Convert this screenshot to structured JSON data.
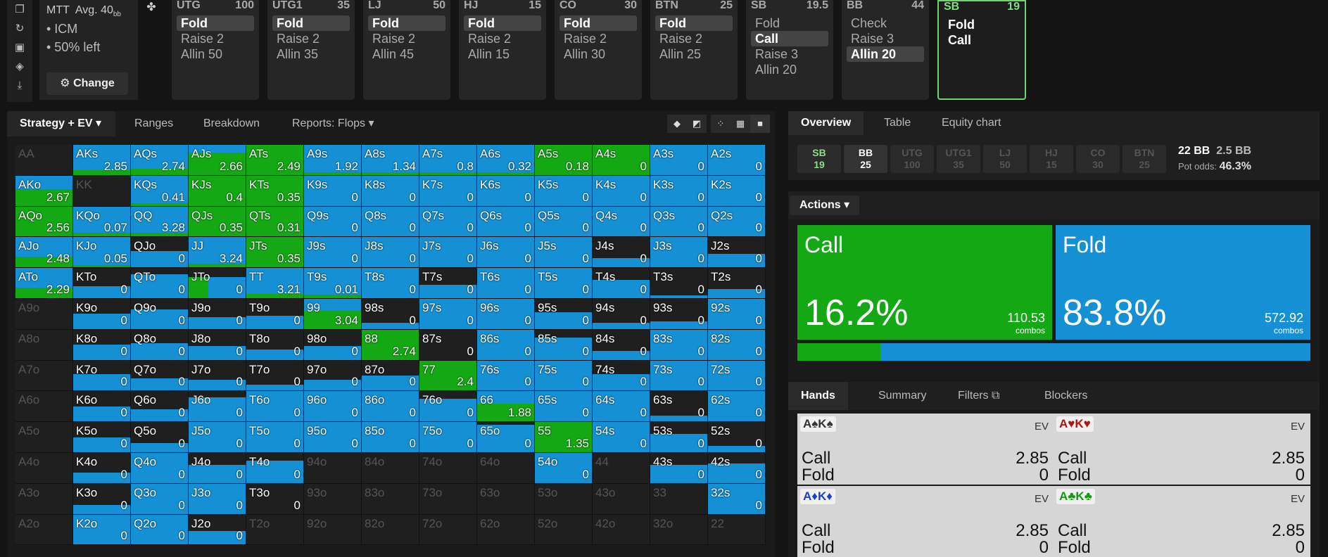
{
  "left_icons": [
    "bookmark-icon",
    "refresh-icon",
    "save-icon",
    "gamepad-icon",
    "collapse-icon"
  ],
  "info": {
    "title": "MTT",
    "avg_label": "Avg. 40",
    "avg_unit": "bb",
    "items": [
      "• ICM",
      "• 50% left"
    ],
    "change_label": "Change",
    "change_icon": "⚙"
  },
  "positions": [
    {
      "name": "UTG",
      "stack": "100",
      "actions": [
        "Fold",
        "Raise 2",
        "Allin 50"
      ],
      "selected": 0
    },
    {
      "name": "UTG1",
      "stack": "35",
      "actions": [
        "Fold",
        "Raise 2",
        "Allin 35"
      ],
      "selected": 0
    },
    {
      "name": "LJ",
      "stack": "50",
      "actions": [
        "Fold",
        "Raise 2",
        "Allin 45"
      ],
      "selected": 0
    },
    {
      "name": "HJ",
      "stack": "15",
      "actions": [
        "Fold",
        "Raise 2",
        "Allin 15"
      ],
      "selected": 0
    },
    {
      "name": "CO",
      "stack": "30",
      "actions": [
        "Fold",
        "Raise 2",
        "Allin 30"
      ],
      "selected": 0
    },
    {
      "name": "BTN",
      "stack": "25",
      "actions": [
        "Fold",
        "Raise 2",
        "Allin 25"
      ],
      "selected": 0
    },
    {
      "name": "SB",
      "stack": "19.5",
      "actions": [
        "Fold",
        "Call",
        "Raise 3",
        "Allin 20"
      ],
      "selected": 1
    },
    {
      "name": "BB",
      "stack": "44",
      "actions": [
        "Check",
        "Raise 3",
        "Allin 20"
      ],
      "selected": 2
    },
    {
      "name": "SB",
      "stack": "19",
      "actions": [
        "Fold",
        "Call"
      ],
      "selected": -1,
      "active": true
    }
  ],
  "grid_tabs": [
    "Strategy + EV",
    "Ranges",
    "Breakdown",
    "Reports: Flops"
  ],
  "grid_tab_active": 0,
  "view_buttons": [
    "◆",
    "◩",
    "⁘",
    "▦",
    "■"
  ],
  "colors": {
    "call": "#14a814",
    "fold": "#1590d4",
    "empty": "#1f1f1f"
  },
  "hands": [
    [
      "AA",
      "",
      -1
    ],
    [
      "AKs",
      "2.85",
      0.15
    ],
    [
      "AQs",
      "2.74",
      0.2
    ],
    [
      "AJs",
      "2.66",
      0.75
    ],
    [
      "ATs",
      "2.49",
      1
    ],
    [
      "A9s",
      "1.92",
      0.08
    ],
    [
      "A8s",
      "1.34",
      0.08
    ],
    [
      "A7s",
      "0.8",
      0.1
    ],
    [
      "A6s",
      "0.32",
      0.1
    ],
    [
      "A5s",
      "0.18",
      1
    ],
    [
      "A4s",
      "0",
      1,
      0.05
    ],
    [
      "A3s",
      "0",
      0
    ],
    [
      "A2s",
      "0",
      0
    ],
    [
      "AKo",
      "2.67",
      0.55
    ],
    [
      "KK",
      "",
      -1
    ],
    [
      "KQs",
      "0.41",
      0.08
    ],
    [
      "KJs",
      "0.4",
      1
    ],
    [
      "KTs",
      "0.35",
      1
    ],
    [
      "K9s",
      "0",
      0
    ],
    [
      "K8s",
      "0",
      0
    ],
    [
      "K7s",
      "0",
      0
    ],
    [
      "K6s",
      "0",
      0
    ],
    [
      "K5s",
      "0",
      0
    ],
    [
      "K4s",
      "0",
      0
    ],
    [
      "K3s",
      "0",
      0
    ],
    [
      "K2s",
      "0",
      0
    ],
    [
      "AQo",
      "2.56",
      1
    ],
    [
      "KQo",
      "0.07",
      0.12
    ],
    [
      "QQ",
      "3.28",
      0.12
    ],
    [
      "QJs",
      "0.35",
      1
    ],
    [
      "QTs",
      "0.31",
      1
    ],
    [
      "Q9s",
      "0",
      0
    ],
    [
      "Q8s",
      "0",
      0
    ],
    [
      "Q7s",
      "0",
      0
    ],
    [
      "Q6s",
      "0",
      0
    ],
    [
      "Q5s",
      "0",
      0
    ],
    [
      "Q4s",
      "0",
      0
    ],
    [
      "Q3s",
      "0",
      0
    ],
    [
      "Q2s",
      "0",
      0
    ],
    [
      "AJo",
      "2.48",
      0.35
    ],
    [
      "KJo",
      "0.05",
      0.08
    ],
    [
      "QJo",
      "0",
      0,
      0.55
    ],
    [
      "JJ",
      "3.24",
      0.12
    ],
    [
      "JTs",
      "0.35",
      1
    ],
    [
      "J9s",
      "0",
      0
    ],
    [
      "J8s",
      "0",
      0
    ],
    [
      "J7s",
      "0",
      0
    ],
    [
      "J6s",
      "0",
      0
    ],
    [
      "J5s",
      "0",
      0
    ],
    [
      "J4s",
      "0",
      0,
      0.3
    ],
    [
      "J3s",
      "0",
      0
    ],
    [
      "J2s",
      "0",
      0,
      0.45
    ],
    [
      "ATo",
      "2.29",
      0.35
    ],
    [
      "KTo",
      "0",
      0,
      0.4
    ],
    [
      "QTo",
      "0",
      0,
      0.8
    ],
    [
      "JTo",
      "0",
      0,
      0.7,
      0.35
    ],
    [
      "TT",
      "3.21",
      0.15
    ],
    [
      "T9s",
      "0.01",
      0.12
    ],
    [
      "T8s",
      "0",
      0
    ],
    [
      "T7s",
      "0",
      0,
      0.45
    ],
    [
      "T6s",
      "0",
      0
    ],
    [
      "T5s",
      "0",
      0
    ],
    [
      "T4s",
      "0",
      0,
      0.6
    ],
    [
      "T3s",
      "0",
      0,
      0.1
    ],
    [
      "T2s",
      "0",
      0,
      0.3
    ],
    [
      "A9o",
      "",
      -1
    ],
    [
      "K9o",
      "0",
      0,
      0.5
    ],
    [
      "Q9o",
      "0",
      0,
      0.65
    ],
    [
      "J9o",
      "0",
      0,
      0.4
    ],
    [
      "T9o",
      "0",
      0,
      0.45
    ],
    [
      "99",
      "3.04",
      0.6
    ],
    [
      "98s",
      "0",
      0,
      0.2
    ],
    [
      "97s",
      "0",
      0
    ],
    [
      "96s",
      "0",
      0
    ],
    [
      "95s",
      "0",
      0,
      0.55
    ],
    [
      "94s",
      "0",
      0,
      0.2
    ],
    [
      "93s",
      "0",
      0,
      0.25
    ],
    [
      "92s",
      "0",
      0
    ],
    [
      "A8o",
      "",
      -1
    ],
    [
      "K8o",
      "0",
      0,
      0.5
    ],
    [
      "Q8o",
      "0",
      0,
      0.55
    ],
    [
      "J8o",
      "0",
      0,
      0.45
    ],
    [
      "T8o",
      "0",
      0,
      0.35
    ],
    [
      "98o",
      "0",
      0,
      0.45
    ],
    [
      "88",
      "2.74",
      1
    ],
    [
      "87s",
      "0",
      0,
      0
    ],
    [
      "86s",
      "0",
      0
    ],
    [
      "85s",
      "0",
      0,
      0.75
    ],
    [
      "84s",
      "0",
      0,
      0.3
    ],
    [
      "83s",
      "0",
      0
    ],
    [
      "82s",
      "0",
      0
    ],
    [
      "A7o",
      "",
      -1
    ],
    [
      "K7o",
      "0",
      0,
      0.55
    ],
    [
      "Q7o",
      "0",
      0,
      0.4
    ],
    [
      "J7o",
      "0",
      0,
      0.35
    ],
    [
      "T7o",
      "0",
      0,
      0.2
    ],
    [
      "97o",
      "0",
      0,
      0.35
    ],
    [
      "87o",
      "0",
      0,
      0.5
    ],
    [
      "77",
      "2.4",
      1
    ],
    [
      "76s",
      "0",
      0
    ],
    [
      "75s",
      "0",
      0
    ],
    [
      "74s",
      "0",
      0,
      0.55
    ],
    [
      "73s",
      "0",
      0
    ],
    [
      "72s",
      "0",
      0
    ],
    [
      "A6o",
      "",
      -1
    ],
    [
      "K6o",
      "0",
      0,
      0.5
    ],
    [
      "Q6o",
      "0",
      0,
      0.4
    ],
    [
      "J6o",
      "0",
      0,
      0.8
    ],
    [
      "T6o",
      "0",
      0
    ],
    [
      "96o",
      "0",
      0
    ],
    [
      "86o",
      "0",
      0
    ],
    [
      "76o",
      "0",
      0,
      0.75
    ],
    [
      "66",
      "1.88",
      0.6
    ],
    [
      "65s",
      "0",
      0
    ],
    [
      "64s",
      "0",
      0
    ],
    [
      "63s",
      "0",
      0,
      0.2
    ],
    [
      "62s",
      "0",
      0
    ],
    [
      "A5o",
      "",
      -1
    ],
    [
      "K5o",
      "0",
      0,
      0.5
    ],
    [
      "Q5o",
      "0",
      0,
      0.3
    ],
    [
      "J5o",
      "0",
      0
    ],
    [
      "T5o",
      "0",
      0
    ],
    [
      "95o",
      "0",
      0
    ],
    [
      "85o",
      "0",
      0
    ],
    [
      "75o",
      "0",
      0
    ],
    [
      "65o",
      "0",
      0,
      0.9
    ],
    [
      "55",
      "1.35",
      1
    ],
    [
      "54s",
      "0",
      0
    ],
    [
      "53s",
      "0",
      0,
      0.6
    ],
    [
      "52s",
      "0",
      0,
      0.2
    ],
    [
      "A4o",
      "",
      -1
    ],
    [
      "K4o",
      "0",
      0,
      0.35
    ],
    [
      "Q4o",
      "0",
      0
    ],
    [
      "J4o",
      "0",
      0,
      0.6
    ],
    [
      "T4o",
      "0",
      0,
      0.75
    ],
    [
      "94o",
      "",
      -1
    ],
    [
      "84o",
      "",
      -1
    ],
    [
      "74o",
      "",
      -1
    ],
    [
      "64o",
      "",
      -1
    ],
    [
      "54o",
      "0",
      0
    ],
    [
      "44",
      "",
      -1
    ],
    [
      "43s",
      "0",
      0,
      0.6
    ],
    [
      "42s",
      "0",
      0,
      0.65
    ],
    [
      "A3o",
      "",
      -1
    ],
    [
      "K3o",
      "0",
      0,
      0.3
    ],
    [
      "Q3o",
      "0",
      0
    ],
    [
      "J3o",
      "0",
      0
    ],
    [
      "T3o",
      "0",
      0,
      0
    ],
    [
      "93o",
      "",
      -1
    ],
    [
      "83o",
      "",
      -1
    ],
    [
      "73o",
      "",
      -1
    ],
    [
      "63o",
      "",
      -1
    ],
    [
      "53o",
      "",
      -1
    ],
    [
      "43o",
      "",
      -1
    ],
    [
      "33",
      "",
      -1
    ],
    [
      "32s",
      "0",
      0
    ],
    [
      "A2o",
      "",
      -1
    ],
    [
      "K2o",
      "0",
      0
    ],
    [
      "Q2o",
      "0",
      0
    ],
    [
      "J2o",
      "0",
      0,
      0.45
    ],
    [
      "T2o",
      "",
      -1
    ],
    [
      "92o",
      "",
      -1
    ],
    [
      "82o",
      "",
      -1
    ],
    [
      "72o",
      "",
      -1
    ],
    [
      "62o",
      "",
      -1
    ],
    [
      "52o",
      "",
      -1
    ],
    [
      "42o",
      "",
      -1
    ],
    [
      "32o",
      "",
      -1
    ],
    [
      "22",
      "",
      -1
    ]
  ],
  "right_tabs": [
    "Overview",
    "Table",
    "Equity chart"
  ],
  "chips": [
    {
      "n": "SB",
      "s": "19",
      "c": "g"
    },
    {
      "n": "BB",
      "s": "25",
      "c": "w"
    },
    {
      "n": "UTG",
      "s": "100",
      "c": ""
    },
    {
      "n": "UTG1",
      "s": "35",
      "c": ""
    },
    {
      "n": "LJ",
      "s": "50",
      "c": ""
    },
    {
      "n": "HJ",
      "s": "15",
      "c": ""
    },
    {
      "n": "CO",
      "s": "30",
      "c": ""
    },
    {
      "n": "BTN",
      "s": "25",
      "c": ""
    }
  ],
  "pot": {
    "line1a": "22 BB",
    "line1b": "2.5 BB",
    "odds_label": "Pot odds:",
    "odds": "46.3%"
  },
  "actions_label": "Actions",
  "summary": [
    {
      "name": "Call",
      "pct": "16.2%",
      "combos": "110.53",
      "frac": 0.162
    },
    {
      "name": "Fold",
      "pct": "83.8%",
      "combos": "572.92",
      "frac": 0.838
    }
  ],
  "combos_label": "combos",
  "bottom_tabs": [
    "Hands",
    "Summary",
    "Filters",
    "Blockers"
  ],
  "hand_cards": [
    {
      "card": "A♠K♠",
      "color": "#333",
      "call": "2.85",
      "fold": "0"
    },
    {
      "card": "A♥K♥",
      "color": "#b01515",
      "call": "2.85",
      "fold": "0"
    },
    {
      "card": "A♦K♦",
      "color": "#1f3fcf",
      "call": "2.85",
      "fold": "0"
    },
    {
      "card": "A♣K♣",
      "color": "#139a13",
      "call": "2.85",
      "fold": "0"
    }
  ],
  "ev_label": "EV"
}
